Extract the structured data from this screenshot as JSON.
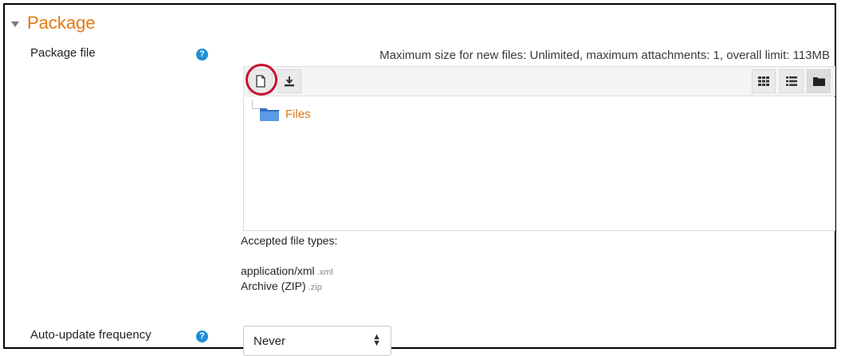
{
  "section": {
    "title": "Package"
  },
  "package_file": {
    "label": "Package file",
    "max_info": "Maximum size for new files: Unlimited, maximum attachments: 1, overall limit: 113MB",
    "folder_name": "Files",
    "accepted_heading": "Accepted file types:",
    "types": [
      {
        "name": "application/xml",
        "ext": ".xml"
      },
      {
        "name": "Archive (ZIP)",
        "ext": ".zip"
      }
    ]
  },
  "auto_update": {
    "label": "Auto-update frequency",
    "selected": "Never"
  },
  "help_icon_glyph": "?",
  "icons": {
    "add_file": "file-icon",
    "download": "download-icon",
    "view_icons": "grid-icon",
    "view_list": "list-icon",
    "view_tree": "folder-icon"
  },
  "colors": {
    "accent": "#e47714",
    "help": "#1f8dd6",
    "highlight": "#c8102e"
  }
}
